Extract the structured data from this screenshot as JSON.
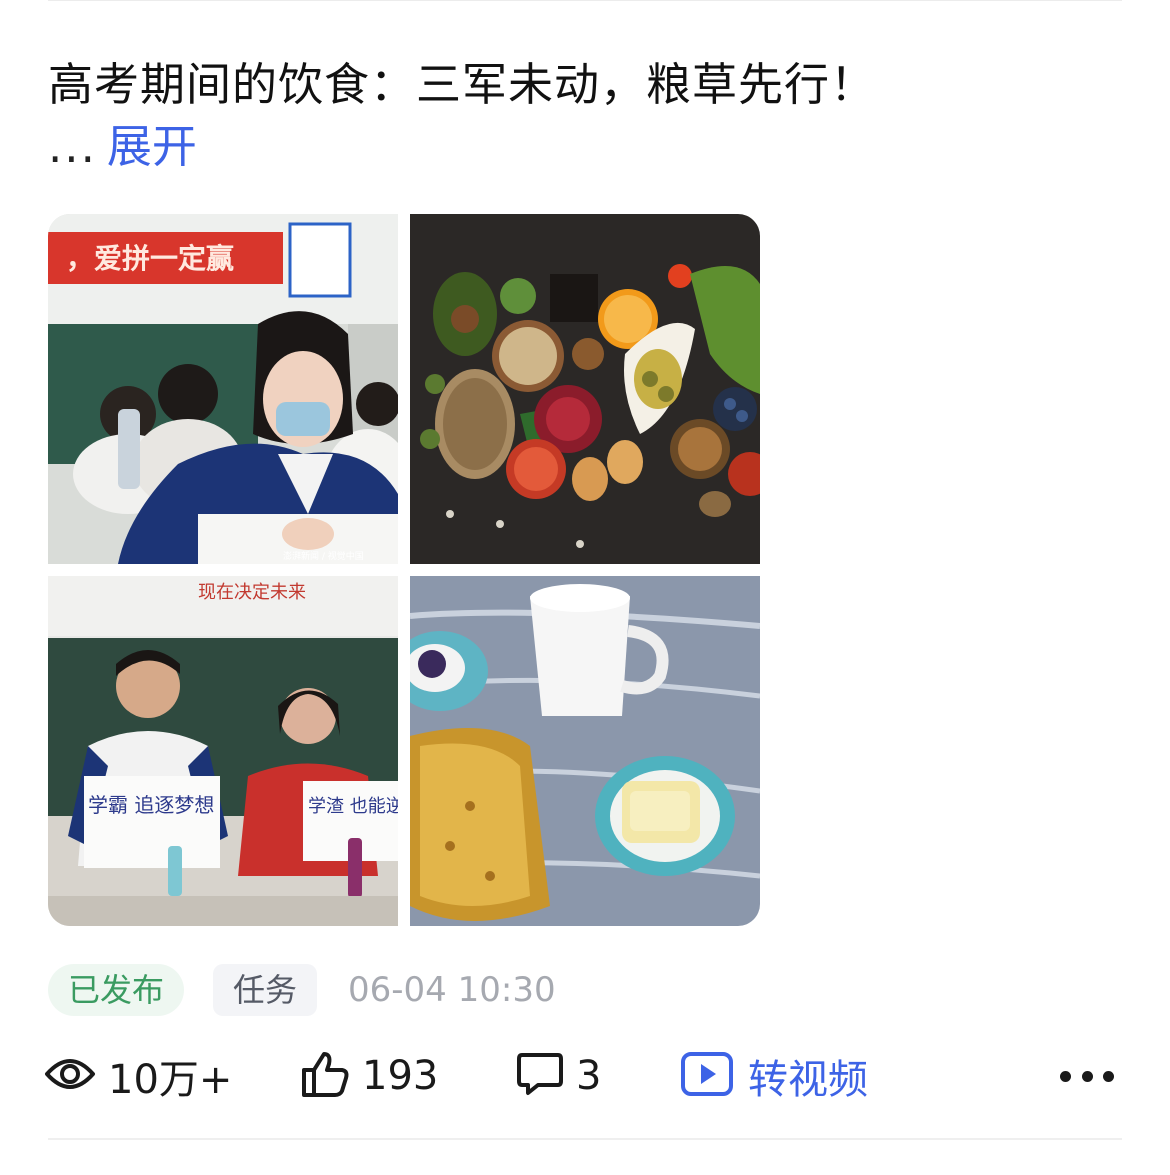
{
  "post": {
    "title": "高考期间的饮食：三军未动，粮草先行！",
    "ellipsis": "...",
    "expand_label": "展开"
  },
  "images": [
    {
      "name": "students-exam-photo",
      "banner_text": "，爱拼一定赢",
      "watermark": "澎湃新闻 / 视觉中国"
    },
    {
      "name": "healthy-food-spread-photo"
    },
    {
      "name": "students-holding-signs-photo",
      "banner_text": "现在决定未来",
      "sign_left": "学霸 追逐梦想",
      "sign_right": "学渣 也能逆"
    },
    {
      "name": "breakfast-milk-pancake-photo"
    }
  ],
  "meta": {
    "status_badge": "已发布",
    "type_badge": "任务",
    "timestamp": "06-04 10:30"
  },
  "stats": {
    "views": "10万+",
    "likes": "193",
    "comments": "3",
    "to_video_label": "转视频"
  },
  "icons": {
    "views": "eye-icon",
    "likes": "thumb-up-icon",
    "comments": "comment-bubble-icon",
    "video": "play-video-icon",
    "more": "more-dots-icon"
  },
  "colors": {
    "accent": "#3d63e6",
    "published_text": "#3a9b61",
    "published_bg": "#eef7f1",
    "muted": "#a6a9b0"
  }
}
